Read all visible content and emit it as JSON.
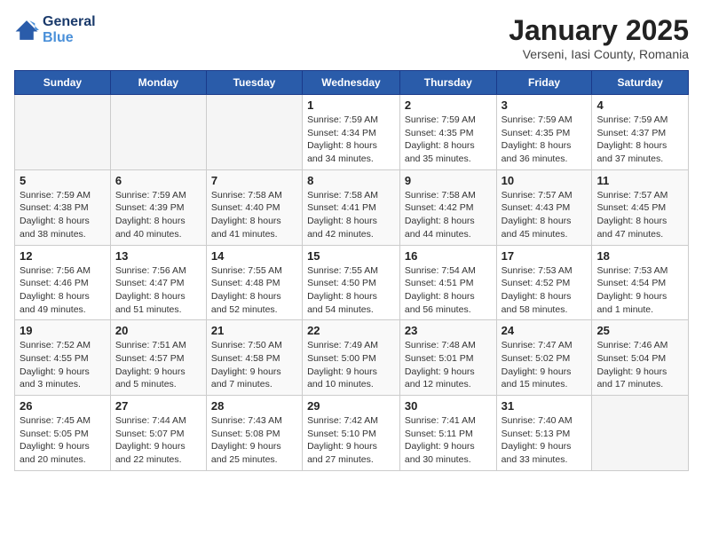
{
  "header": {
    "logo_line1": "General",
    "logo_line2": "Blue",
    "month": "January 2025",
    "location": "Verseni, Iasi County, Romania"
  },
  "days_of_week": [
    "Sunday",
    "Monday",
    "Tuesday",
    "Wednesday",
    "Thursday",
    "Friday",
    "Saturday"
  ],
  "weeks": [
    [
      {
        "day": "",
        "info": ""
      },
      {
        "day": "",
        "info": ""
      },
      {
        "day": "",
        "info": ""
      },
      {
        "day": "1",
        "info": "Sunrise: 7:59 AM\nSunset: 4:34 PM\nDaylight: 8 hours\nand 34 minutes."
      },
      {
        "day": "2",
        "info": "Sunrise: 7:59 AM\nSunset: 4:35 PM\nDaylight: 8 hours\nand 35 minutes."
      },
      {
        "day": "3",
        "info": "Sunrise: 7:59 AM\nSunset: 4:35 PM\nDaylight: 8 hours\nand 36 minutes."
      },
      {
        "day": "4",
        "info": "Sunrise: 7:59 AM\nSunset: 4:37 PM\nDaylight: 8 hours\nand 37 minutes."
      }
    ],
    [
      {
        "day": "5",
        "info": "Sunrise: 7:59 AM\nSunset: 4:38 PM\nDaylight: 8 hours\nand 38 minutes."
      },
      {
        "day": "6",
        "info": "Sunrise: 7:59 AM\nSunset: 4:39 PM\nDaylight: 8 hours\nand 40 minutes."
      },
      {
        "day": "7",
        "info": "Sunrise: 7:58 AM\nSunset: 4:40 PM\nDaylight: 8 hours\nand 41 minutes."
      },
      {
        "day": "8",
        "info": "Sunrise: 7:58 AM\nSunset: 4:41 PM\nDaylight: 8 hours\nand 42 minutes."
      },
      {
        "day": "9",
        "info": "Sunrise: 7:58 AM\nSunset: 4:42 PM\nDaylight: 8 hours\nand 44 minutes."
      },
      {
        "day": "10",
        "info": "Sunrise: 7:57 AM\nSunset: 4:43 PM\nDaylight: 8 hours\nand 45 minutes."
      },
      {
        "day": "11",
        "info": "Sunrise: 7:57 AM\nSunset: 4:45 PM\nDaylight: 8 hours\nand 47 minutes."
      }
    ],
    [
      {
        "day": "12",
        "info": "Sunrise: 7:56 AM\nSunset: 4:46 PM\nDaylight: 8 hours\nand 49 minutes."
      },
      {
        "day": "13",
        "info": "Sunrise: 7:56 AM\nSunset: 4:47 PM\nDaylight: 8 hours\nand 51 minutes."
      },
      {
        "day": "14",
        "info": "Sunrise: 7:55 AM\nSunset: 4:48 PM\nDaylight: 8 hours\nand 52 minutes."
      },
      {
        "day": "15",
        "info": "Sunrise: 7:55 AM\nSunset: 4:50 PM\nDaylight: 8 hours\nand 54 minutes."
      },
      {
        "day": "16",
        "info": "Sunrise: 7:54 AM\nSunset: 4:51 PM\nDaylight: 8 hours\nand 56 minutes."
      },
      {
        "day": "17",
        "info": "Sunrise: 7:53 AM\nSunset: 4:52 PM\nDaylight: 8 hours\nand 58 minutes."
      },
      {
        "day": "18",
        "info": "Sunrise: 7:53 AM\nSunset: 4:54 PM\nDaylight: 9 hours\nand 1 minute."
      }
    ],
    [
      {
        "day": "19",
        "info": "Sunrise: 7:52 AM\nSunset: 4:55 PM\nDaylight: 9 hours\nand 3 minutes."
      },
      {
        "day": "20",
        "info": "Sunrise: 7:51 AM\nSunset: 4:57 PM\nDaylight: 9 hours\nand 5 minutes."
      },
      {
        "day": "21",
        "info": "Sunrise: 7:50 AM\nSunset: 4:58 PM\nDaylight: 9 hours\nand 7 minutes."
      },
      {
        "day": "22",
        "info": "Sunrise: 7:49 AM\nSunset: 5:00 PM\nDaylight: 9 hours\nand 10 minutes."
      },
      {
        "day": "23",
        "info": "Sunrise: 7:48 AM\nSunset: 5:01 PM\nDaylight: 9 hours\nand 12 minutes."
      },
      {
        "day": "24",
        "info": "Sunrise: 7:47 AM\nSunset: 5:02 PM\nDaylight: 9 hours\nand 15 minutes."
      },
      {
        "day": "25",
        "info": "Sunrise: 7:46 AM\nSunset: 5:04 PM\nDaylight: 9 hours\nand 17 minutes."
      }
    ],
    [
      {
        "day": "26",
        "info": "Sunrise: 7:45 AM\nSunset: 5:05 PM\nDaylight: 9 hours\nand 20 minutes."
      },
      {
        "day": "27",
        "info": "Sunrise: 7:44 AM\nSunset: 5:07 PM\nDaylight: 9 hours\nand 22 minutes."
      },
      {
        "day": "28",
        "info": "Sunrise: 7:43 AM\nSunset: 5:08 PM\nDaylight: 9 hours\nand 25 minutes."
      },
      {
        "day": "29",
        "info": "Sunrise: 7:42 AM\nSunset: 5:10 PM\nDaylight: 9 hours\nand 27 minutes."
      },
      {
        "day": "30",
        "info": "Sunrise: 7:41 AM\nSunset: 5:11 PM\nDaylight: 9 hours\nand 30 minutes."
      },
      {
        "day": "31",
        "info": "Sunrise: 7:40 AM\nSunset: 5:13 PM\nDaylight: 9 hours\nand 33 minutes."
      },
      {
        "day": "",
        "info": ""
      }
    ]
  ]
}
